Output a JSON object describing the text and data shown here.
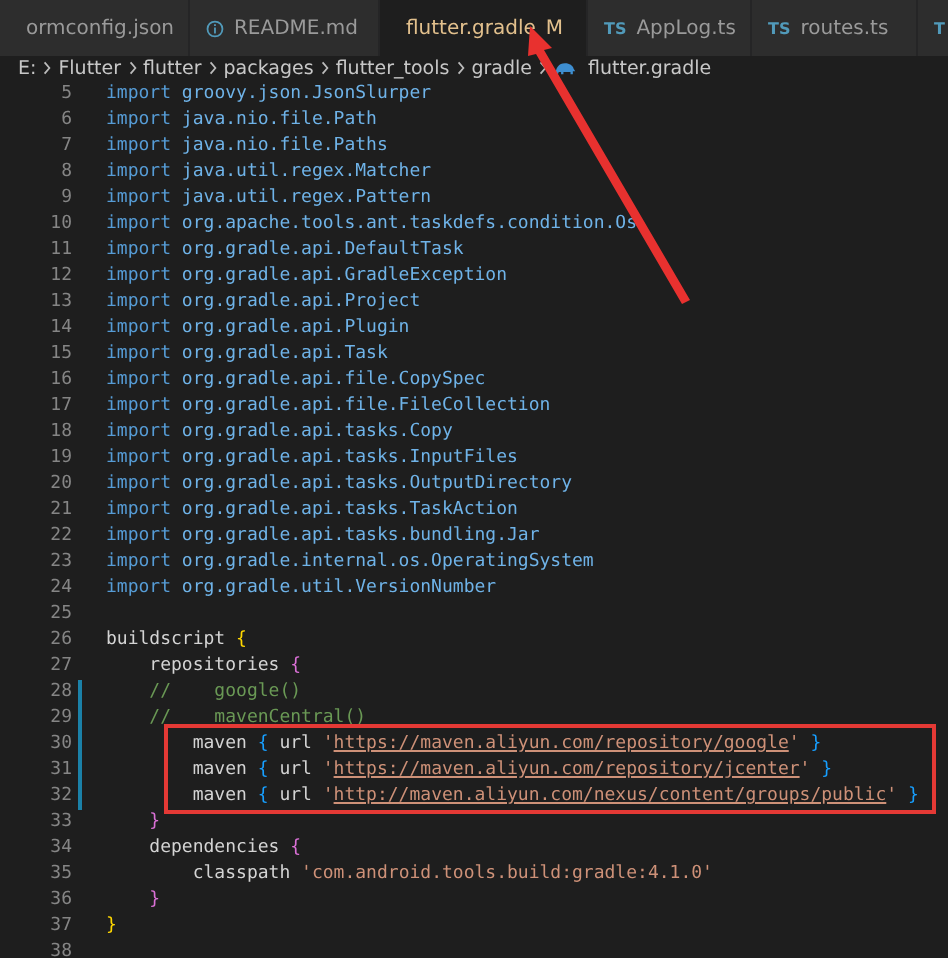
{
  "tabs": [
    {
      "kind": "json",
      "label": "ormconfig.json",
      "selected": false
    },
    {
      "kind": "info",
      "label": "README.md",
      "selected": false
    },
    {
      "kind": "gradle",
      "label": "flutter.gradle",
      "selected": true,
      "status": "M"
    },
    {
      "kind": "ts",
      "badge": "TS",
      "label": "AppLog.ts",
      "selected": false
    },
    {
      "kind": "ts",
      "badge": "TS",
      "label": "routes.ts",
      "selected": false
    },
    {
      "kind": "ts",
      "badge": "T",
      "selected": false
    }
  ],
  "breadcrumb": [
    {
      "label": "E:"
    },
    {
      "label": "Flutter"
    },
    {
      "label": "flutter"
    },
    {
      "label": "packages"
    },
    {
      "label": "flutter_tools"
    },
    {
      "label": "gradle"
    },
    {
      "label": "flutter.gradle",
      "kind": "gradle"
    }
  ],
  "lines": [
    {
      "num": "5",
      "tokens": [
        {
          "kind": "keyword",
          "t": "import"
        },
        {
          "kind": "pkg",
          "t": " groovy.json.JsonSlurper"
        }
      ]
    },
    {
      "num": "6",
      "tokens": [
        {
          "kind": "keyword",
          "t": "import"
        },
        {
          "kind": "pkg",
          "t": " java.nio.file.Path"
        }
      ]
    },
    {
      "num": "7",
      "tokens": [
        {
          "kind": "keyword",
          "t": "import"
        },
        {
          "kind": "pkg",
          "t": " java.nio.file.Paths"
        }
      ]
    },
    {
      "num": "8",
      "tokens": [
        {
          "kind": "keyword",
          "t": "import"
        },
        {
          "kind": "pkg",
          "t": " java.util.regex.Matcher"
        }
      ]
    },
    {
      "num": "9",
      "tokens": [
        {
          "kind": "keyword",
          "t": "import"
        },
        {
          "kind": "pkg",
          "t": " java.util.regex.Pattern"
        }
      ]
    },
    {
      "num": "10",
      "tokens": [
        {
          "kind": "keyword",
          "t": "import"
        },
        {
          "kind": "pkg",
          "t": " org.apache.tools.ant.taskdefs.condition.Os"
        }
      ]
    },
    {
      "num": "11",
      "tokens": [
        {
          "kind": "keyword",
          "t": "import"
        },
        {
          "kind": "pkg",
          "t": " org.gradle.api.DefaultTask"
        }
      ]
    },
    {
      "num": "12",
      "tokens": [
        {
          "kind": "keyword",
          "t": "import"
        },
        {
          "kind": "pkg",
          "t": " org.gradle.api.GradleException"
        }
      ]
    },
    {
      "num": "13",
      "tokens": [
        {
          "kind": "keyword",
          "t": "import"
        },
        {
          "kind": "pkg",
          "t": " org.gradle.api.Project"
        }
      ]
    },
    {
      "num": "14",
      "tokens": [
        {
          "kind": "keyword",
          "t": "import"
        },
        {
          "kind": "pkg",
          "t": " org.gradle.api.Plugin"
        }
      ]
    },
    {
      "num": "15",
      "tokens": [
        {
          "kind": "keyword",
          "t": "import"
        },
        {
          "kind": "pkg",
          "t": " org.gradle.api.Task"
        }
      ]
    },
    {
      "num": "16",
      "tokens": [
        {
          "kind": "keyword",
          "t": "import"
        },
        {
          "kind": "pkg",
          "t": " org.gradle.api.file.CopySpec"
        }
      ]
    },
    {
      "num": "17",
      "tokens": [
        {
          "kind": "keyword",
          "t": "import"
        },
        {
          "kind": "pkg",
          "t": " org.gradle.api.file.FileCollection"
        }
      ]
    },
    {
      "num": "18",
      "tokens": [
        {
          "kind": "keyword",
          "t": "import"
        },
        {
          "kind": "pkg",
          "t": " org.gradle.api.tasks.Copy"
        }
      ]
    },
    {
      "num": "19",
      "tokens": [
        {
          "kind": "keyword",
          "t": "import"
        },
        {
          "kind": "pkg",
          "t": " org.gradle.api.tasks.InputFiles"
        }
      ]
    },
    {
      "num": "20",
      "tokens": [
        {
          "kind": "keyword",
          "t": "import"
        },
        {
          "kind": "pkg",
          "t": " org.gradle.api.tasks.OutputDirectory"
        }
      ]
    },
    {
      "num": "21",
      "tokens": [
        {
          "kind": "keyword",
          "t": "import"
        },
        {
          "kind": "pkg",
          "t": " org.gradle.api.tasks.TaskAction"
        }
      ]
    },
    {
      "num": "22",
      "tokens": [
        {
          "kind": "keyword",
          "t": "import"
        },
        {
          "kind": "pkg",
          "t": " org.gradle.api.tasks.bundling.Jar"
        }
      ]
    },
    {
      "num": "23",
      "tokens": [
        {
          "kind": "keyword",
          "t": "import"
        },
        {
          "kind": "pkg",
          "t": " org.gradle.internal.os.OperatingSystem"
        }
      ]
    },
    {
      "num": "24",
      "tokens": [
        {
          "kind": "keyword",
          "t": "import"
        },
        {
          "kind": "pkg",
          "t": " org.gradle.util.VersionNumber"
        }
      ]
    },
    {
      "num": "25"
    },
    {
      "num": "26",
      "tokens": [
        {
          "kind": "plain",
          "t": "buildscript "
        },
        {
          "kind": "brace1",
          "t": "{"
        }
      ]
    },
    {
      "num": "27",
      "tokens": [
        {
          "kind": "plain",
          "t": "    repositories "
        },
        {
          "kind": "brace2",
          "t": "{"
        }
      ]
    },
    {
      "num": "28",
      "modified": true,
      "tokens": [
        {
          "kind": "comment",
          "t": "    //    google()"
        }
      ]
    },
    {
      "num": "29",
      "modified": true,
      "tokens": [
        {
          "kind": "comment",
          "t": "    //    mavenCentral()"
        }
      ]
    },
    {
      "num": "30",
      "modified": true,
      "tokens": [
        {
          "kind": "plain",
          "t": "        maven "
        },
        {
          "kind": "brace3",
          "t": "{"
        },
        {
          "kind": "plain",
          "t": " url "
        },
        {
          "kind": "string",
          "t": "'"
        },
        {
          "kind": "url",
          "t": "https://maven.aliyun.com/repository/google"
        },
        {
          "kind": "string",
          "t": "'"
        },
        {
          "kind": "brace3",
          "t": " }"
        }
      ]
    },
    {
      "num": "31",
      "modified": true,
      "tokens": [
        {
          "kind": "plain",
          "t": "        maven "
        },
        {
          "kind": "brace3",
          "t": "{"
        },
        {
          "kind": "plain",
          "t": " url "
        },
        {
          "kind": "string",
          "t": "'"
        },
        {
          "kind": "url",
          "t": "https://maven.aliyun.com/repository/jcenter"
        },
        {
          "kind": "string",
          "t": "'"
        },
        {
          "kind": "brace3",
          "t": " }"
        }
      ]
    },
    {
      "num": "32",
      "modified": true,
      "tokens": [
        {
          "kind": "plain",
          "t": "        maven "
        },
        {
          "kind": "brace3",
          "t": "{"
        },
        {
          "kind": "plain",
          "t": " url "
        },
        {
          "kind": "string",
          "t": "'"
        },
        {
          "kind": "url",
          "t": "http://maven.aliyun.com/nexus/content/groups/public"
        },
        {
          "kind": "string",
          "t": "'"
        },
        {
          "kind": "brace3",
          "t": " }"
        }
      ]
    },
    {
      "num": "33",
      "tokens": [
        {
          "kind": "brace2",
          "t": "    }"
        }
      ]
    },
    {
      "num": "34",
      "tokens": [
        {
          "kind": "plain",
          "t": "    dependencies "
        },
        {
          "kind": "brace2",
          "t": "{"
        }
      ]
    },
    {
      "num": "35",
      "tokens": [
        {
          "kind": "plain",
          "t": "        classpath "
        },
        {
          "kind": "string",
          "t": "'com.android.tools.build:gradle:4.1.0'"
        }
      ]
    },
    {
      "num": "36",
      "tokens": [
        {
          "kind": "brace2",
          "t": "    }"
        }
      ]
    },
    {
      "num": "37",
      "tokens": [
        {
          "kind": "brace1",
          "t": "}"
        }
      ]
    },
    {
      "num": "38"
    }
  ]
}
